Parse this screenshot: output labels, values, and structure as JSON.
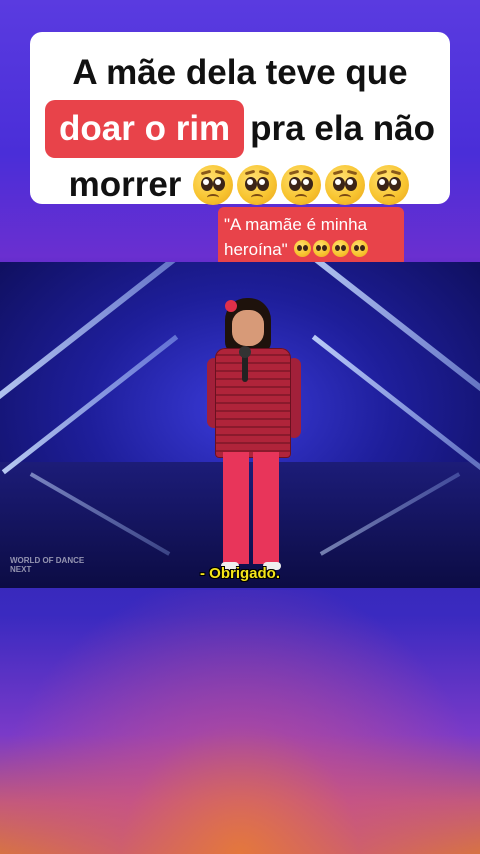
{
  "caption": {
    "line1": "A mãe dela teve que",
    "highlight": "doar o rim",
    "line2_rest": "pra ela não",
    "line3": "morrer",
    "emoji_name": "pleading-face-emoji",
    "emoji_count": 5
  },
  "quote_badge": {
    "text_line1": "\"A mamãe é minha",
    "text_line2": "heroína\"",
    "emoji_name": "pleading-face-emoji",
    "emoji_count": 4
  },
  "video": {
    "subtitle": "- Obrigado.",
    "watermark_line1": "WORLD OF DANCE",
    "watermark_line2": "NEXT"
  },
  "colors": {
    "highlight_bg": "#e8434a",
    "subtitle_color": "#f5e51a",
    "caption_bg": "#ffffff"
  }
}
